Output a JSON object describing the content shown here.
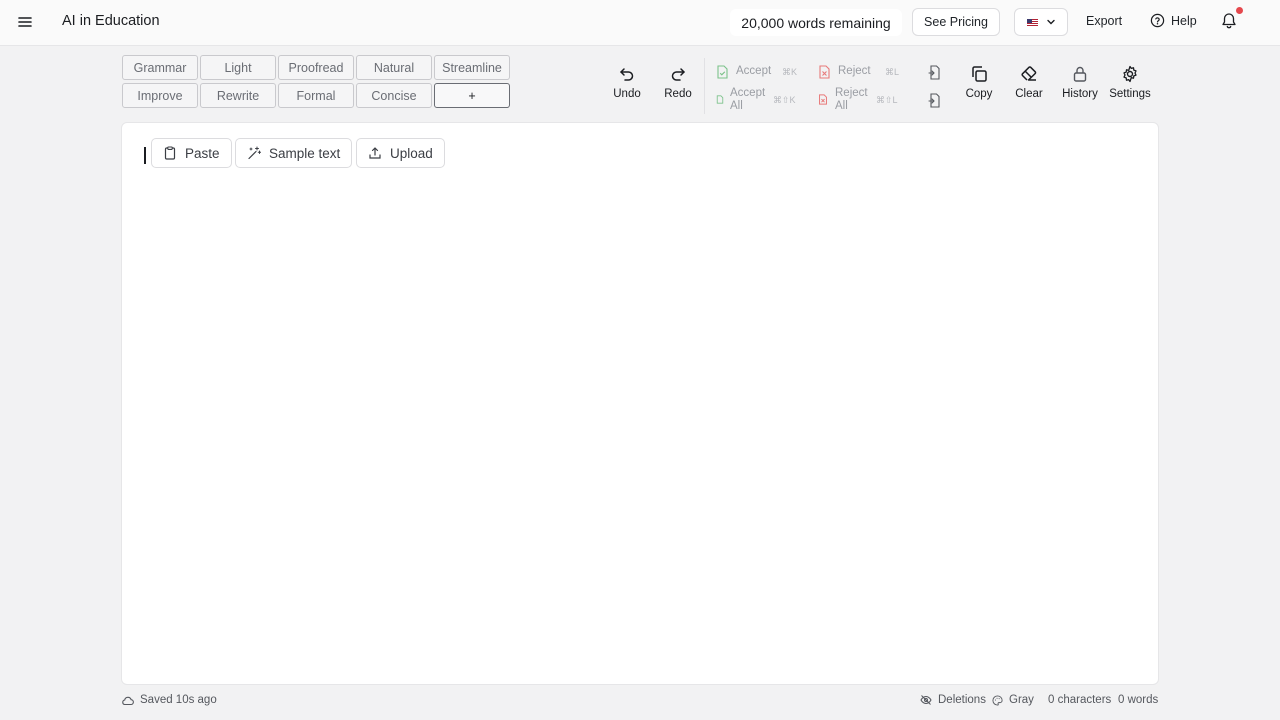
{
  "header": {
    "app_title": "AI in Education",
    "words_remaining": "20,000 words remaining",
    "pricing_label": "See Pricing",
    "export_label": "Export",
    "help_label": "Help"
  },
  "modes": {
    "row1": [
      "Grammar",
      "Light",
      "Proofread",
      "Natural",
      "Streamline"
    ],
    "row2": [
      "Improve",
      "Rewrite",
      "Formal",
      "Concise",
      "+"
    ]
  },
  "toolbar": {
    "undo": "Undo",
    "redo": "Redo",
    "accept": "Accept",
    "accept_shortcut": "⌘K",
    "accept_all_1": "Accept",
    "accept_all_2": "All",
    "accept_all_shortcut": "⌘⇧K",
    "reject": "Reject",
    "reject_shortcut": "⌘L",
    "reject_all_1": "Reject",
    "reject_all_2": "All",
    "reject_all_shortcut": "⌘⇧L",
    "copy": "Copy",
    "clear": "Clear",
    "history": "History",
    "settings": "Settings"
  },
  "editor": {
    "paste": "Paste",
    "sample": "Sample text",
    "upload": "Upload"
  },
  "footer": {
    "saved": "Saved 10s ago",
    "deletions": "Deletions",
    "color": "Gray",
    "characters": "0 characters",
    "words": "0 words"
  },
  "colors": {
    "accent_green": "#7cc28a",
    "accent_red": "#e87a7a",
    "notification": "#e5484d"
  }
}
